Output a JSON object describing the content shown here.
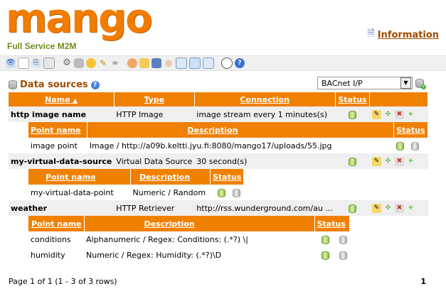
{
  "logo": {
    "word": "mango",
    "tagline": "Full Service M2M"
  },
  "header": {
    "info_label": "Information"
  },
  "data_sources": {
    "title": "Data sources",
    "type_select": "BACnet I/P",
    "columns": {
      "name": "Name",
      "type": "Type",
      "connection": "Connection",
      "status": "Status"
    },
    "rows": [
      {
        "name": "http image name",
        "type": "HTTP Image",
        "connection": "image stream every 1 minutes(s)",
        "points": {
          "headers": {
            "name": "Point name",
            "description": "Description",
            "status": "Status"
          },
          "items": [
            {
              "name": "image point",
              "description": "Image / http://a09b.keltti.jyu.fi:8080/mango17/uploads/55.jpg"
            }
          ]
        }
      },
      {
        "name": "my-virtual-data-source",
        "type": "Virtual Data Source",
        "connection": "30 second(s)",
        "points": {
          "headers": {
            "name": "Point name",
            "description": "Description",
            "status": "Status"
          },
          "items": [
            {
              "name": "my-virtual-data-point",
              "description": "Numeric / Random"
            }
          ]
        }
      },
      {
        "name": "weather",
        "type": "HTTP Retriever",
        "connection": "http://rss.wunderground.com/au ...",
        "points": {
          "headers": {
            "name": "Point name",
            "description": "Description",
            "status": "Status"
          },
          "items": [
            {
              "name": "conditions",
              "description": "Alphanumeric / Regex: Conditions: (.*?) \\|"
            },
            {
              "name": "humidity",
              "description": "Numeric / Regex: Humidity: (.*?)\\D"
            }
          ]
        }
      }
    ],
    "pager": {
      "summary": "Page 1 of 1 (1 - 3 of 3 rows)",
      "page": "1"
    }
  }
}
